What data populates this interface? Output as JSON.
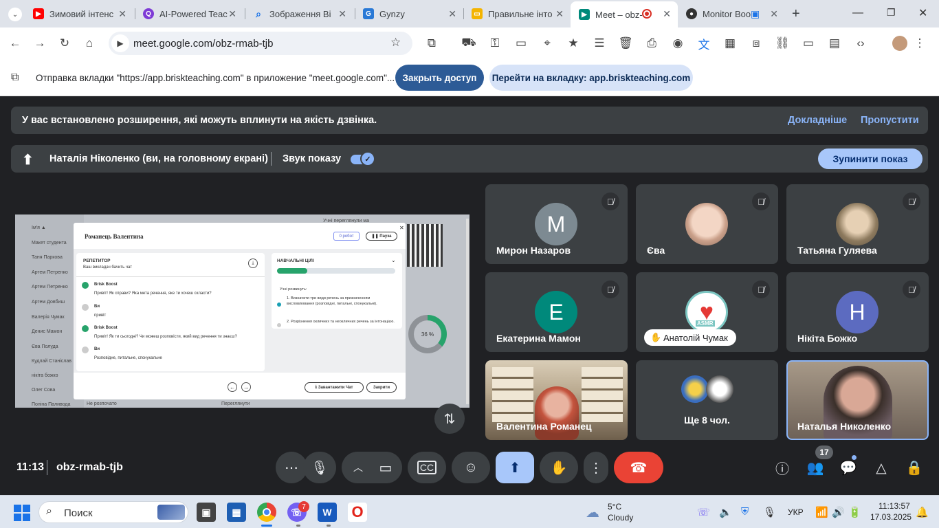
{
  "browser": {
    "tabs": [
      {
        "title": "Зимовий інтенс",
        "favicon": "youtube-icon",
        "color": "#ff0000"
      },
      {
        "title": "AI-Powered Teac",
        "favicon": "q-icon",
        "color": "#7e3bd6"
      },
      {
        "title": "Зображення Ві",
        "favicon": "search-icon",
        "color": "#1a73e8"
      },
      {
        "title": "Gynzy",
        "favicon": "gynzy-icon",
        "color": "#2979d6"
      },
      {
        "title": "Правильне інто",
        "favicon": "slides-icon",
        "color": "#f4b400"
      },
      {
        "title": "Meet – obz-",
        "favicon": "meet-icon",
        "color": "#00897b"
      },
      {
        "title": "Monitor Boo",
        "favicon": "monitor-icon",
        "color": "#333333"
      }
    ],
    "url": "meet.google.com/obz-rmab-tjb",
    "infobar": {
      "message": "Отправка вкладки \"https://app.briskteaching.com\" в приложение \"meet.google.com\"...",
      "stop_label": "Закрыть доступ",
      "goto_label": "Перейти на вкладку: app.briskteaching.com"
    }
  },
  "meet": {
    "warning": {
      "text": "У вас встановлено розширення, які можуть вплинути на якість дзвінка.",
      "learn_more": "Докладніше",
      "dismiss": "Пропустити"
    },
    "presenting": {
      "text": "Наталія Ніколенко (ви, на головному екрані)",
      "sound_label": "Звук показу",
      "stop_label": "Зупинити показ"
    },
    "participants": [
      {
        "name": "Мирон Назаров",
        "initial": "M",
        "color": "#7d8a92",
        "type": "initial"
      },
      {
        "name": "Єва",
        "type": "photo",
        "color": "#e9c9b6"
      },
      {
        "name": "Татьяна Гуляева",
        "type": "photo",
        "color": "#c9b79a"
      },
      {
        "name": "Екатерина Мамон",
        "initial": "E",
        "color": "#00897b",
        "type": "initial"
      },
      {
        "name": "Анатолій Чумак",
        "type": "asmr",
        "badge": "ASMR"
      },
      {
        "name": "Нікіта Божко",
        "initial": "Н",
        "color": "#5c6bc0",
        "type": "initial"
      },
      {
        "name": "Валентина Романец",
        "type": "video"
      },
      {
        "name": "Ще 8 чол.",
        "type": "more"
      },
      {
        "name": "Наталья Николенко",
        "type": "video-self"
      }
    ],
    "meeting_time": "11:13",
    "meeting_code": "obz-rmab-tjb",
    "participant_count": "17",
    "shared_screen": {
      "modal_title": "Романець Валентина",
      "work_btn": "0 робот",
      "pause_btn": "Пауза",
      "tutor_title": "РЕПЕТИТОР",
      "tutor_sub": "Ваш викладач бачить чат",
      "messages": [
        {
          "who": "Brisk Boost",
          "text": "Привіт! Як справи? Яка мета речення, яке ти хочеш скласти?"
        },
        {
          "who": "Ви",
          "text": "привіт"
        },
        {
          "who": "Brisk Boost",
          "text": "Привіт! Як ти сьогодні? Чи можеш розповісти, який вид речення ти знаєш?"
        },
        {
          "who": "Ви",
          "text": "Розповідне, питальне, спонукальне"
        }
      ],
      "goals_title": "НАВЧАЛЬНІ ЦІЛІ",
      "goals_intro": "Учні розвинуть:",
      "goals": [
        "1. Визначити три види речень за призначенням висловлювання (розповідні, питальні, спонукальні).",
        "2. Розрізнення окличних та неокличних речень за інтонацією."
      ],
      "download_btn": "Завантажити Чат",
      "close_btn": "Закрити",
      "students_header": "Ім'я ▲",
      "students": [
        "Макет студента",
        "Таня Паркова",
        "Артем Петренко",
        "Артем Петренко",
        "Артем Довбиш",
        "Валерія Чумак",
        "Денис Мамон",
        "Єва Полуда",
        "Кудлай Станіслав",
        "нікіта божко",
        "Олег Сова",
        "Поліна Паливода"
      ],
      "progress_label": "36 %",
      "top_text": "Учні переглянули ма",
      "not_started": "Не розпочато",
      "review": "Переглянути"
    }
  },
  "taskbar": {
    "search_placeholder": "Поиск",
    "weather_temp": "5°C",
    "weather_desc": "Cloudy",
    "lang": "УКР",
    "time": "11:13:57",
    "date": "17.03.2025",
    "viber_badge": "7"
  }
}
